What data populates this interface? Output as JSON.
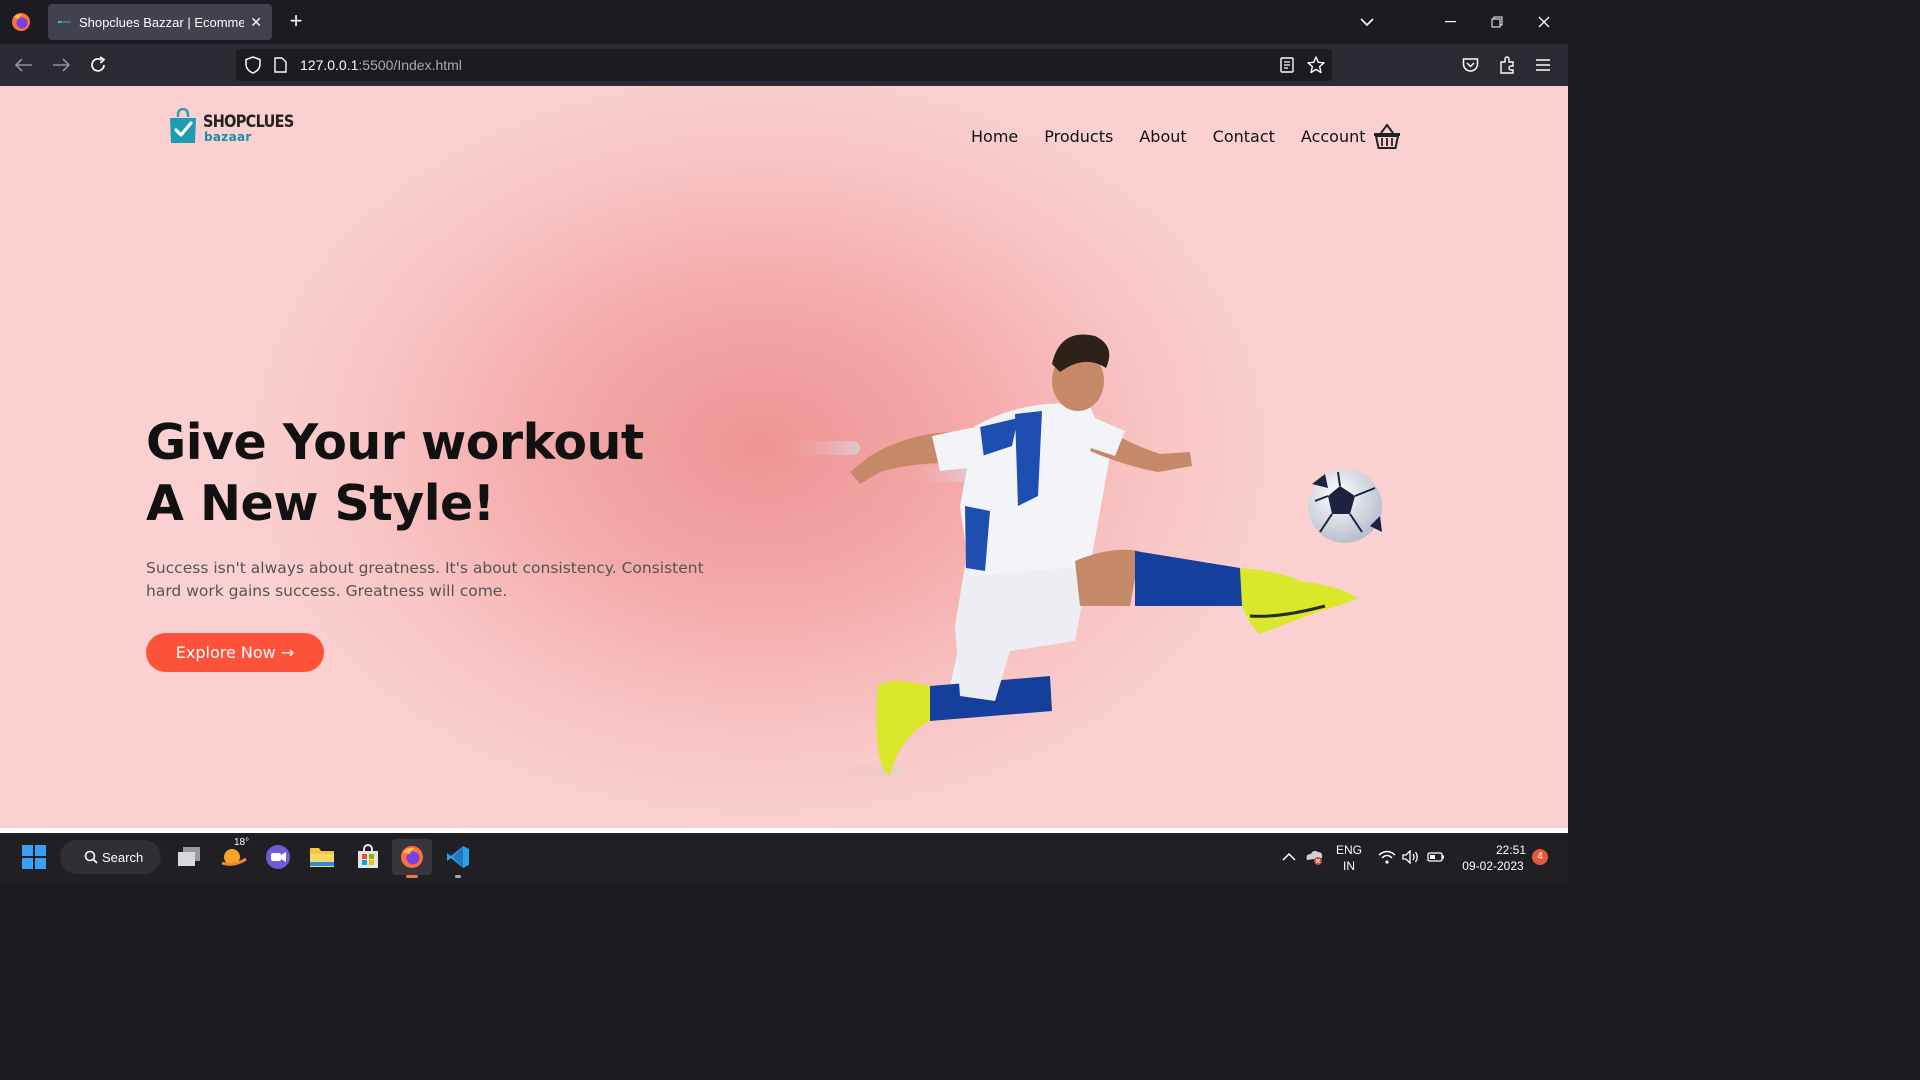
{
  "browser": {
    "tab_title": "Shopclues Bazzar | Ecommerce Website",
    "url_host": "127.0.0.1",
    "url_rest": ":5500/Index.html"
  },
  "site": {
    "brand_name": "SHOPCLUES",
    "brand_sub": "bazaar",
    "nav": [
      "Home",
      "Products",
      "About",
      "Contact",
      "Account"
    ],
    "hero_title_line1": "Give Your workout",
    "hero_title_line2": "A New Style!",
    "hero_text": "Success isn't always about greatness. It's about consistency. Consistent hard work gains success. Greatness will come.",
    "cta_label": "Explore Now →",
    "colors": {
      "accent": "#ff523b",
      "brand_teal": "#1a8ea8",
      "page_bg": "#f9c4c4"
    }
  },
  "taskbar": {
    "search_label": "Search",
    "weather_temp": "18°",
    "lang_line1": "ENG",
    "lang_line2": "IN",
    "time": "22:51",
    "date": "09-02-2023",
    "notification_count": "4"
  },
  "icons": [
    "firefox-icon",
    "back-icon",
    "forward-icon",
    "reload-icon",
    "shield-icon",
    "page-icon",
    "reader-icon",
    "bookmark-star-icon",
    "pocket-icon",
    "extensions-icon",
    "menu-icon",
    "cart-icon",
    "windows-start-icon",
    "search-icon",
    "task-view-icon",
    "weather-icon",
    "teams-icon",
    "file-explorer-icon",
    "store-icon",
    "vscode-icon",
    "chevron-up-icon",
    "onedrive-icon",
    "wifi-icon",
    "volume-icon",
    "battery-icon"
  ]
}
